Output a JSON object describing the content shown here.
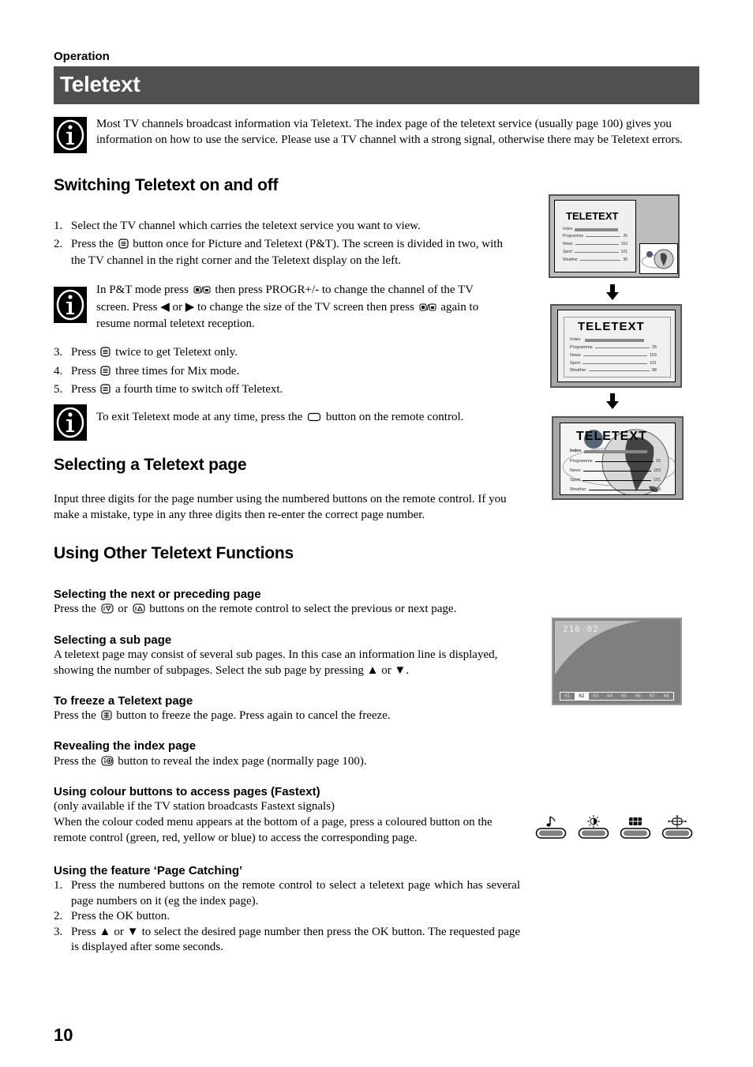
{
  "header": {
    "section_label": "Operation",
    "title": "Teletext"
  },
  "intro_note": "Most TV channels broadcast information via Teletext. The index page of the teletext service (usually page 100) gives you information on how to use the service. Please use a TV channel with a strong signal, otherwise there may be Teletext errors.",
  "switching": {
    "heading": "Switching Teletext on and off",
    "steps": [
      {
        "num": "1.",
        "before": "Select the TV channel which carries the teletext service you want to view.",
        "after": ""
      },
      {
        "num": "2.",
        "before": "Press the",
        "after": "button once for Picture and Teletext (P&T). The screen is divided in two, with the TV channel in the right corner and the Teletext display on the left."
      }
    ],
    "pt_note": {
      "part1": "In P&T mode press",
      "part2": "then press PROGR+/- to change the channel of the TV screen. Press ◀ or ▶ to change the size of the TV screen then press",
      "part3": "again to resume normal teletext reception."
    },
    "steps2": [
      {
        "num": "3.",
        "before": "Press",
        "after": "twice to get Teletext only."
      },
      {
        "num": "4.",
        "before": "Press",
        "after": "three times for Mix mode."
      },
      {
        "num": "5.",
        "before": "Press",
        "after": "a fourth time to switch off Teletext."
      }
    ],
    "exit_note": {
      "before": "To exit Teletext mode at any time, press the",
      "after": "button on the remote control."
    }
  },
  "selecting_page": {
    "heading": "Selecting a Teletext page",
    "body": "Input three digits for the page number using the numbered buttons on the remote control. If you make a mistake, type in any three digits then re-enter the correct page number."
  },
  "other_functions": {
    "heading": "Using Other Teletext Functions",
    "next_prev": {
      "heading": "Selecting the next or preceding page",
      "before": "Press the",
      "middle": "or",
      "after": "buttons on the remote control to select the previous or next page."
    },
    "sub_page": {
      "heading": "Selecting a sub page",
      "body": "A teletext page may consist of several sub pages. In this case an information line is displayed, showing the number of subpages. Select the sub page by pressing ▲ or ▼."
    },
    "freeze": {
      "heading": "To freeze a Teletext page",
      "before": "Press the",
      "after": "button to freeze the page. Press again to cancel the freeze."
    },
    "index": {
      "heading": "Revealing the index page",
      "before": "Press the",
      "after": "button to reveal the index page (normally page 100)."
    },
    "fastext": {
      "heading": "Using colour buttons to access pages (Fastext)",
      "line1": "(only available if the TV station broadcasts Fastext signals)",
      "line2": "When the colour coded menu appears at the bottom of a page, press a coloured button on the remote control (green, red, yellow or blue) to access the corresponding page."
    },
    "page_catching": {
      "heading": "Using the feature ‘Page Catching’",
      "steps": [
        {
          "num": "1.",
          "text": "Press the numbered buttons on the remote control to select a teletext page which has several page numbers on it (eg the index page)."
        },
        {
          "num": "2.",
          "text": "Press the OK button."
        },
        {
          "num": "3.",
          "text": "Press ▲ or ▼ to select the desired page number then press the OK button.  The requested page is displayed after some seconds."
        }
      ]
    }
  },
  "illustrations": {
    "teletext_screen": {
      "title": "TELETEXT",
      "index_label": "Index",
      "rows": [
        {
          "label": "Programme",
          "value": "25"
        },
        {
          "label": "News",
          "value": "153"
        },
        {
          "label": "Sport",
          "value": "101"
        },
        {
          "label": "Weather",
          "value": "98"
        }
      ]
    },
    "subpage_screen": {
      "page_number": "216-02",
      "subpages": [
        "01",
        "02",
        "03",
        "04",
        "05",
        "06",
        "07",
        "08"
      ],
      "active_subpage": "02"
    },
    "fastext_icons": [
      "music-note-icon",
      "brightness-icon",
      "picture-format-icon",
      "position-icon"
    ]
  },
  "footer": {
    "page_number": "10"
  }
}
